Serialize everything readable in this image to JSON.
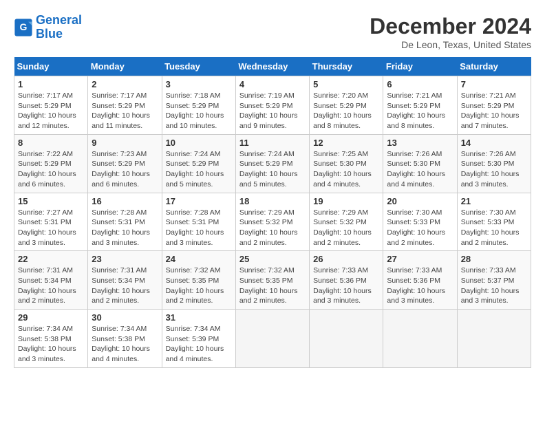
{
  "header": {
    "logo_line1": "General",
    "logo_line2": "Blue",
    "month_title": "December 2024",
    "location": "De Leon, Texas, United States"
  },
  "calendar": {
    "weekdays": [
      "Sunday",
      "Monday",
      "Tuesday",
      "Wednesday",
      "Thursday",
      "Friday",
      "Saturday"
    ],
    "weeks": [
      [
        {
          "day": "1",
          "info": "Sunrise: 7:17 AM\nSunset: 5:29 PM\nDaylight: 10 hours\nand 12 minutes."
        },
        {
          "day": "2",
          "info": "Sunrise: 7:17 AM\nSunset: 5:29 PM\nDaylight: 10 hours\nand 11 minutes."
        },
        {
          "day": "3",
          "info": "Sunrise: 7:18 AM\nSunset: 5:29 PM\nDaylight: 10 hours\nand 10 minutes."
        },
        {
          "day": "4",
          "info": "Sunrise: 7:19 AM\nSunset: 5:29 PM\nDaylight: 10 hours\nand 9 minutes."
        },
        {
          "day": "5",
          "info": "Sunrise: 7:20 AM\nSunset: 5:29 PM\nDaylight: 10 hours\nand 8 minutes."
        },
        {
          "day": "6",
          "info": "Sunrise: 7:21 AM\nSunset: 5:29 PM\nDaylight: 10 hours\nand 8 minutes."
        },
        {
          "day": "7",
          "info": "Sunrise: 7:21 AM\nSunset: 5:29 PM\nDaylight: 10 hours\nand 7 minutes."
        }
      ],
      [
        {
          "day": "8",
          "info": "Sunrise: 7:22 AM\nSunset: 5:29 PM\nDaylight: 10 hours\nand 6 minutes."
        },
        {
          "day": "9",
          "info": "Sunrise: 7:23 AM\nSunset: 5:29 PM\nDaylight: 10 hours\nand 6 minutes."
        },
        {
          "day": "10",
          "info": "Sunrise: 7:24 AM\nSunset: 5:29 PM\nDaylight: 10 hours\nand 5 minutes."
        },
        {
          "day": "11",
          "info": "Sunrise: 7:24 AM\nSunset: 5:29 PM\nDaylight: 10 hours\nand 5 minutes."
        },
        {
          "day": "12",
          "info": "Sunrise: 7:25 AM\nSunset: 5:30 PM\nDaylight: 10 hours\nand 4 minutes."
        },
        {
          "day": "13",
          "info": "Sunrise: 7:26 AM\nSunset: 5:30 PM\nDaylight: 10 hours\nand 4 minutes."
        },
        {
          "day": "14",
          "info": "Sunrise: 7:26 AM\nSunset: 5:30 PM\nDaylight: 10 hours\nand 3 minutes."
        }
      ],
      [
        {
          "day": "15",
          "info": "Sunrise: 7:27 AM\nSunset: 5:31 PM\nDaylight: 10 hours\nand 3 minutes."
        },
        {
          "day": "16",
          "info": "Sunrise: 7:28 AM\nSunset: 5:31 PM\nDaylight: 10 hours\nand 3 minutes."
        },
        {
          "day": "17",
          "info": "Sunrise: 7:28 AM\nSunset: 5:31 PM\nDaylight: 10 hours\nand 3 minutes."
        },
        {
          "day": "18",
          "info": "Sunrise: 7:29 AM\nSunset: 5:32 PM\nDaylight: 10 hours\nand 2 minutes."
        },
        {
          "day": "19",
          "info": "Sunrise: 7:29 AM\nSunset: 5:32 PM\nDaylight: 10 hours\nand 2 minutes."
        },
        {
          "day": "20",
          "info": "Sunrise: 7:30 AM\nSunset: 5:33 PM\nDaylight: 10 hours\nand 2 minutes."
        },
        {
          "day": "21",
          "info": "Sunrise: 7:30 AM\nSunset: 5:33 PM\nDaylight: 10 hours\nand 2 minutes."
        }
      ],
      [
        {
          "day": "22",
          "info": "Sunrise: 7:31 AM\nSunset: 5:34 PM\nDaylight: 10 hours\nand 2 minutes."
        },
        {
          "day": "23",
          "info": "Sunrise: 7:31 AM\nSunset: 5:34 PM\nDaylight: 10 hours\nand 2 minutes."
        },
        {
          "day": "24",
          "info": "Sunrise: 7:32 AM\nSunset: 5:35 PM\nDaylight: 10 hours\nand 2 minutes."
        },
        {
          "day": "25",
          "info": "Sunrise: 7:32 AM\nSunset: 5:35 PM\nDaylight: 10 hours\nand 2 minutes."
        },
        {
          "day": "26",
          "info": "Sunrise: 7:33 AM\nSunset: 5:36 PM\nDaylight: 10 hours\nand 3 minutes."
        },
        {
          "day": "27",
          "info": "Sunrise: 7:33 AM\nSunset: 5:36 PM\nDaylight: 10 hours\nand 3 minutes."
        },
        {
          "day": "28",
          "info": "Sunrise: 7:33 AM\nSunset: 5:37 PM\nDaylight: 10 hours\nand 3 minutes."
        }
      ],
      [
        {
          "day": "29",
          "info": "Sunrise: 7:34 AM\nSunset: 5:38 PM\nDaylight: 10 hours\nand 3 minutes."
        },
        {
          "day": "30",
          "info": "Sunrise: 7:34 AM\nSunset: 5:38 PM\nDaylight: 10 hours\nand 4 minutes."
        },
        {
          "day": "31",
          "info": "Sunrise: 7:34 AM\nSunset: 5:39 PM\nDaylight: 10 hours\nand 4 minutes."
        },
        {
          "day": "",
          "info": ""
        },
        {
          "day": "",
          "info": ""
        },
        {
          "day": "",
          "info": ""
        },
        {
          "day": "",
          "info": ""
        }
      ]
    ]
  }
}
